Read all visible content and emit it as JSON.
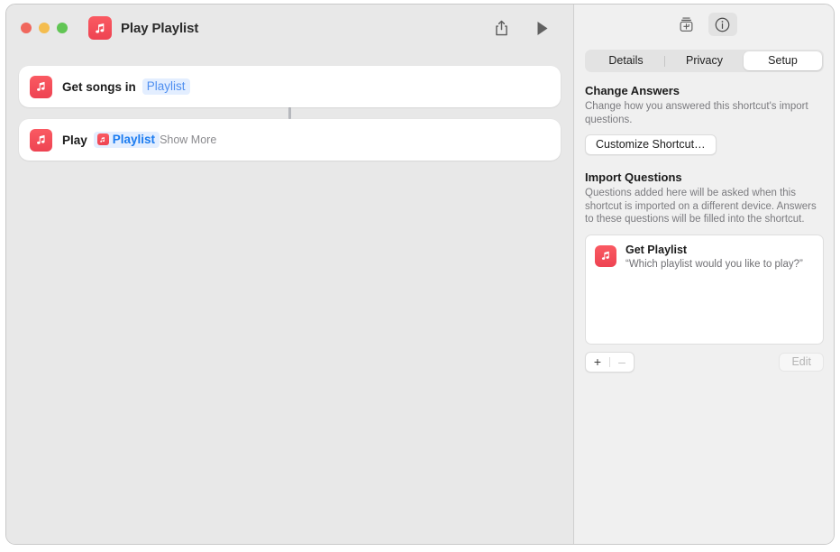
{
  "window": {
    "title": "Play Playlist",
    "app_icon": "music-note-icon",
    "traffic_lights": [
      {
        "name": "close",
        "color": "#f0675d"
      },
      {
        "name": "minimize",
        "color": "#f4bd4f"
      },
      {
        "name": "zoom",
        "color": "#61c554"
      }
    ],
    "toolbar": {
      "share_label": "share-icon",
      "play_label": "play-icon"
    }
  },
  "canvas": {
    "actions": [
      {
        "icon": "music-note-icon",
        "text": "Get songs in",
        "token": "Playlist",
        "token_has_icon": false,
        "trailing": ""
      },
      {
        "icon": "music-note-icon",
        "text": "Play",
        "token": "Playlist",
        "token_has_icon": true,
        "trailing": "Show More"
      }
    ]
  },
  "inspector": {
    "toolbar_buttons": [
      {
        "name": "add-shortcut-icon",
        "active": false
      },
      {
        "name": "info-icon",
        "active": true
      }
    ],
    "tabs": [
      {
        "label": "Details",
        "selected": false
      },
      {
        "label": "Privacy",
        "selected": false
      },
      {
        "label": "Setup",
        "selected": true
      }
    ],
    "change_answers": {
      "title": "Change Answers",
      "description": "Change how you answered this shortcut's import questions.",
      "button_label": "Customize Shortcut…"
    },
    "import_questions": {
      "title": "Import Questions",
      "description": "Questions added here will be asked when this shortcut is imported on a different device. Answers to these questions will be filled into the shortcut.",
      "items": [
        {
          "icon": "music-note-icon",
          "title": "Get Playlist",
          "question": "“Which playlist would you like to play?”"
        }
      ],
      "add_label": "+",
      "remove_label": "–",
      "edit_label": "Edit"
    }
  },
  "colors": {
    "accent_red": "#ee4352",
    "token_blue": "#4f8ff0",
    "token_blue_strong": "#1a7bf0",
    "token_bg": "#e3eeff"
  }
}
